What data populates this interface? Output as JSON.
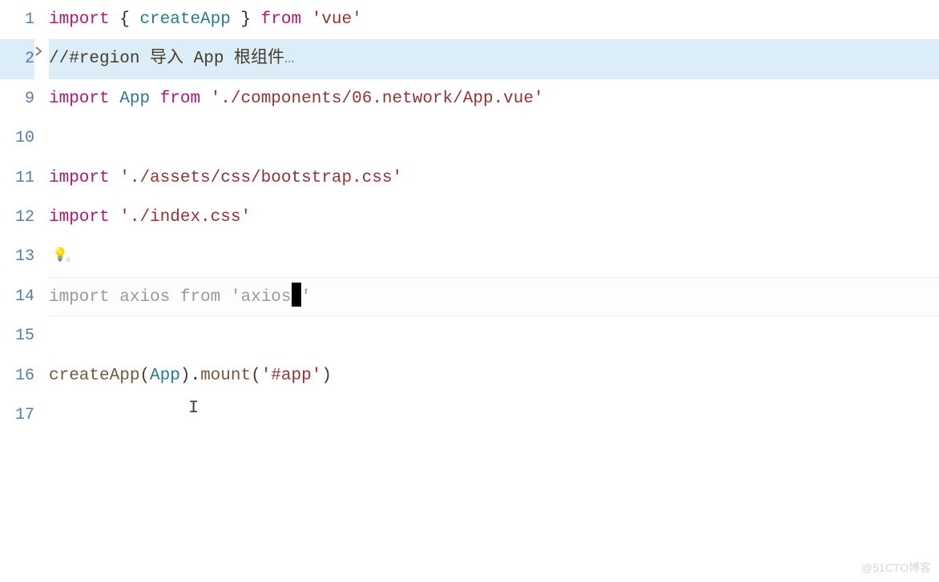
{
  "lines": {
    "1": {
      "num": "1"
    },
    "2": {
      "num": "2"
    },
    "9": {
      "num": "9"
    },
    "10": {
      "num": "10"
    },
    "11": {
      "num": "11"
    },
    "12": {
      "num": "12"
    },
    "13": {
      "num": "13"
    },
    "14": {
      "num": "14"
    },
    "15": {
      "num": "15"
    },
    "16": {
      "num": "16"
    },
    "17": {
      "num": "17"
    }
  },
  "code": {
    "l1": {
      "import": "import",
      "lbrace": " { ",
      "ident": "createApp",
      "rbrace": " } ",
      "from": "from",
      "space": " ",
      "str": "'vue'"
    },
    "l2": {
      "comment": "//#region 导入 App 根组件",
      "dots": "…"
    },
    "l9": {
      "import": "import",
      "space1": " ",
      "ident": "App",
      "space2": " ",
      "from": "from",
      "space3": " ",
      "str": "'./components/06.network/App.vue'"
    },
    "l11": {
      "import": "import",
      "space": " ",
      "str": "'./assets/css/bootstrap.css'"
    },
    "l12": {
      "import": "import",
      "space": " ",
      "str": "'./index.css'"
    },
    "l14": {
      "import": "import",
      "space1": " ",
      "ident": "axios",
      "space2": " ",
      "from": "from",
      "space3": " ",
      "str1": "'axios",
      "str2": "'"
    },
    "l16": {
      "fn1": "createApp",
      "lp1": "(",
      "arg1": "App",
      "rp1": ")",
      "dot": ".",
      "fn2": "mount",
      "lp2": "(",
      "arg2": "'#app'",
      "rp2": ")"
    }
  },
  "watermark": "@51CTO博客"
}
